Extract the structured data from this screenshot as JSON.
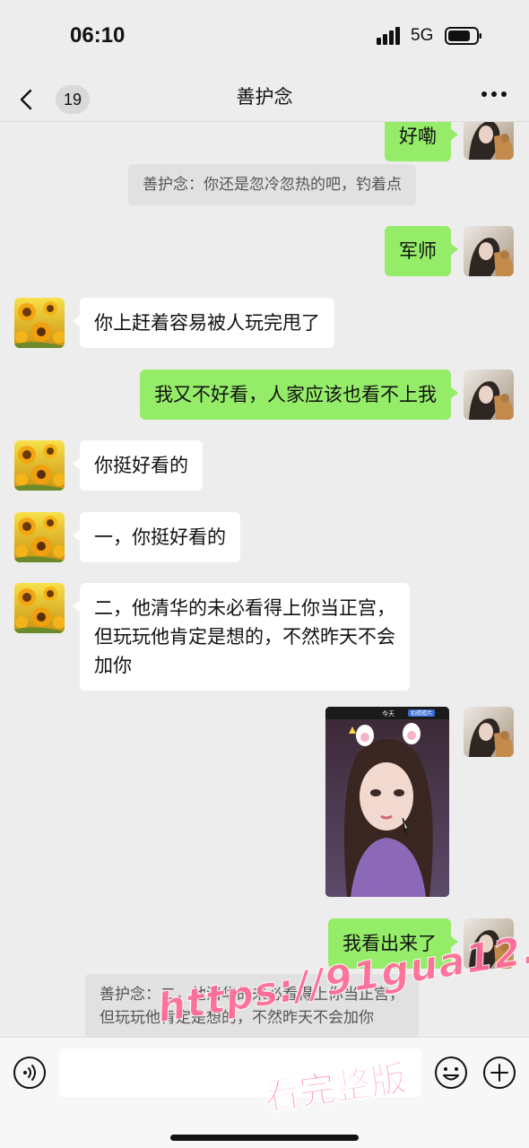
{
  "status_bar": {
    "time": "06:10",
    "network": "5G"
  },
  "nav": {
    "unread_count": "19",
    "title": "善护念"
  },
  "messages": [
    {
      "side": "me",
      "text": "好嘞"
    },
    {
      "type": "quote",
      "text": "善护念：你还是忽冷忽热的吧，钓着点"
    },
    {
      "side": "me",
      "text": "军师"
    },
    {
      "side": "other",
      "text": "你上赶着容易被人玩完甩了"
    },
    {
      "side": "me",
      "text": "我又不好看，人家应该也看不上我"
    },
    {
      "side": "other",
      "text": "你挺好看的"
    },
    {
      "side": "other",
      "text": "一，你挺好看的"
    },
    {
      "side": "other",
      "text": "二，他清华的未必看得上你当正宫，\n但玩玩他肯定是想的，不然昨天不会\n加你"
    },
    {
      "side": "me",
      "type": "image",
      "header_left": "今天",
      "header_right": "拍照照片"
    },
    {
      "side": "me",
      "text": "我看出来了"
    },
    {
      "type": "quote",
      "text": "善护念：二，他清华的未必看得上你当正宫，\n但玩玩他肯定是想的，不然昨天不会加你"
    }
  ],
  "watermark": {
    "url": "https://91gua12.com",
    "cta": "看完整版"
  },
  "colors": {
    "my_bubble": "#95ec69",
    "other_bubble": "#ffffff",
    "background": "#ededed",
    "watermark": "#ff6b97"
  }
}
